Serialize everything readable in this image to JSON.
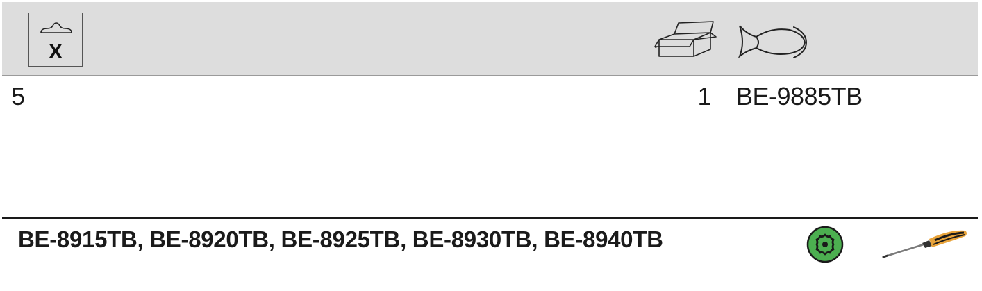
{
  "header": {
    "hang_label": "X",
    "icons": [
      "hang-hole-icon",
      "box-icon",
      "fish-icon"
    ]
  },
  "row": {
    "quantity": "5",
    "pack_quantity": "1",
    "reference": "BE-9885TB"
  },
  "footer": {
    "compatible_refs": "BE-8915TB, BE-8920TB, BE-8925TB, BE-8930TB, BE-8940TB",
    "icons": [
      "torx-icon",
      "screwdriver-icon"
    ],
    "colors": {
      "torx_fill": "#4caf50",
      "screwdriver_handle": "#e8a33a",
      "header_bg": "#dddddd"
    }
  }
}
